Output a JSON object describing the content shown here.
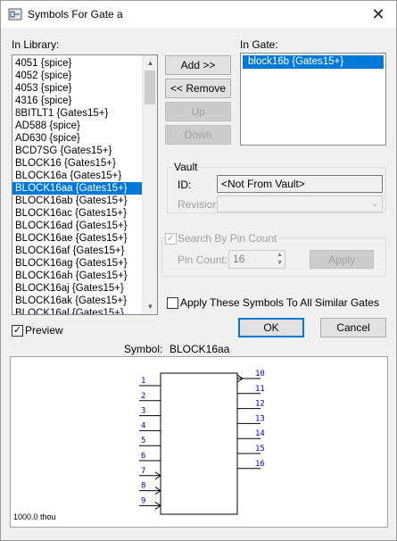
{
  "window": {
    "title": "Symbols For Gate a",
    "close_glyph": "✕"
  },
  "library": {
    "label": "In Library:",
    "items": [
      "4051 {spice}",
      "4052 {spice}",
      "4053 {spice}",
      "4316 {spice}",
      "8BITLT1 {Gates15+}",
      "AD588 {spice}",
      "AD630 {spice}",
      "BCD7SG {Gates15+}",
      "BLOCK16 {Gates15+}",
      "BLOCK16a {Gates15+}",
      "BLOCK16aa {Gates15+}",
      "BLOCK16ab {Gates15+}",
      "BLOCK16ac {Gates15+}",
      "BLOCK16ad {Gates15+}",
      "BLOCK16ae {Gates15+}",
      "BLOCK16af {Gates15+}",
      "BLOCK16ag {Gates15+}",
      "BLOCK16ah {Gates15+}",
      "BLOCK16aj {Gates15+}",
      "BLOCK16ak {Gates15+}",
      "BLOCK16al {Gates15+}"
    ],
    "selected_index": 10
  },
  "buttons": {
    "add": "Add >>",
    "remove": "<< Remove",
    "up": "Up",
    "down": "Down",
    "ok": "OK",
    "cancel": "Cancel",
    "apply": "Apply"
  },
  "in_gate": {
    "label": "In Gate:",
    "items": [
      "block16b {Gates15+}"
    ]
  },
  "vault": {
    "group_label": "Vault",
    "id_label": "ID:",
    "id_value": "<Not From Vault>",
    "revision_label": "Revision:",
    "revision_value": ""
  },
  "pin_count": {
    "checkbox_label": "Search By Pin Count",
    "checked": true,
    "label": "Pin Count:",
    "value": "16"
  },
  "apply_all": {
    "label": "Apply These Symbols To All Similar Gates",
    "checked": false
  },
  "preview": {
    "checkbox_label": "Preview",
    "checked": true,
    "symbol_label": "Symbol:",
    "symbol_name": "BLOCK16aa",
    "left_pins": [
      "1",
      "2",
      "3",
      "4",
      "5",
      "6",
      "7",
      "8",
      "9"
    ],
    "right_pins": [
      "10",
      "11",
      "12",
      "13",
      "14",
      "15",
      "16"
    ],
    "scale": "1000.0 thou"
  },
  "colors": {
    "selection": "#0078d7",
    "pin_numbers": "#0000c0"
  }
}
